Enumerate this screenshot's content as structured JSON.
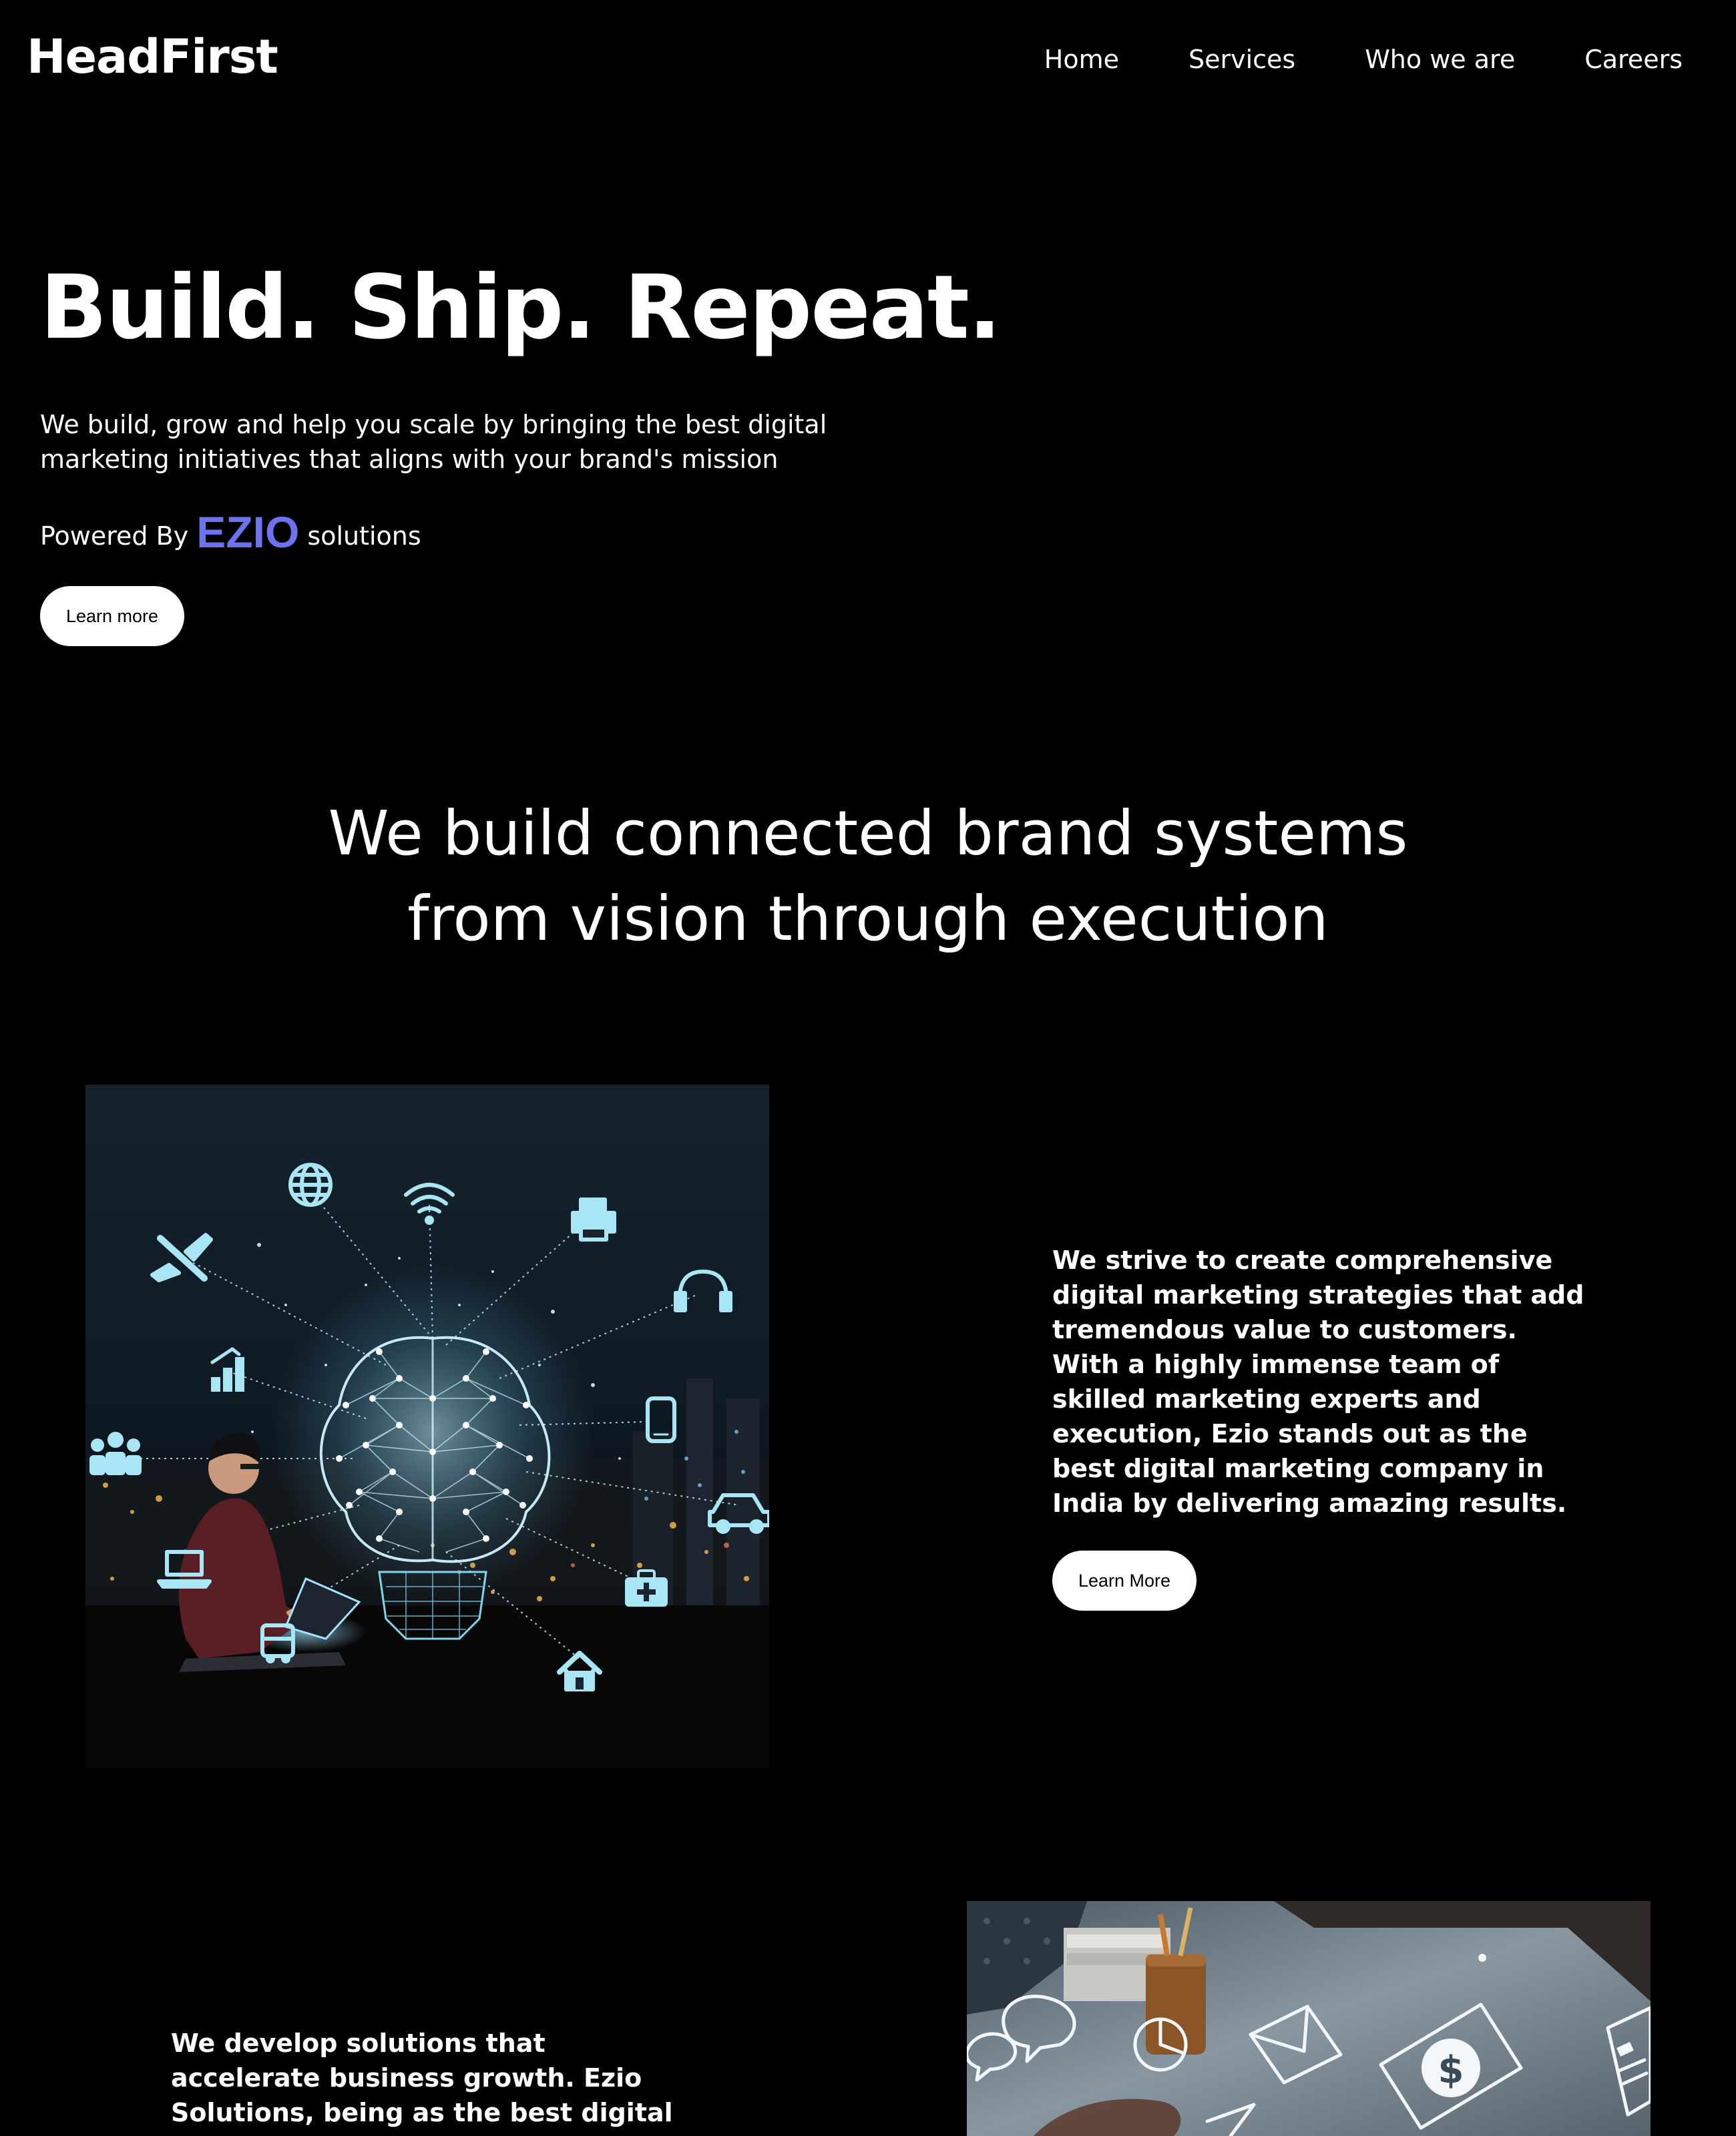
{
  "header": {
    "logo": "HeadFirst",
    "nav": [
      "Home",
      "Services",
      "Who we are",
      "Careers"
    ]
  },
  "hero": {
    "title": "Build. Ship. Repeat.",
    "subtitle": "We build, grow and help you scale by bringing the best digital marketing initiatives that aligns with your brand's mission",
    "powered_prefix": "Powered By",
    "powered_brand": "EZIO",
    "powered_suffix": "solutions",
    "button_label": "Learn more"
  },
  "section": {
    "title_line1": "We build connected brand systems",
    "title_line2": "from vision through execution"
  },
  "feature1": {
    "text": "We strive to create comprehensive digital marketing strategies that add tremendous value to customers. With a highly immense team of skilled marketing experts and execution, Ezio stands out as the best digital marketing company in India by delivering amazing results.",
    "button_label": "Learn More"
  },
  "feature2": {
    "text": "We develop solutions that accelerate business growth. Ezio Solutions, being as the best digital marketing company in"
  },
  "colors": {
    "background": "#000000",
    "text": "#ffffff",
    "brand_accent": "#6d72f0",
    "button_bg": "#ffffff",
    "button_text": "#000000",
    "icon_glow": "#a9e6f5"
  },
  "icons": [
    "globe-icon",
    "wifi-icon",
    "printer-icon",
    "airplane-icon",
    "headphones-icon",
    "bar-chart-icon",
    "smartphone-icon",
    "people-icon",
    "car-icon",
    "laptop-icon",
    "medical-kit-icon",
    "bus-icon",
    "home-icon",
    "speech-bubble-icon",
    "pie-chart-icon",
    "envelope-icon",
    "dollar-icon",
    "document-icon"
  ]
}
